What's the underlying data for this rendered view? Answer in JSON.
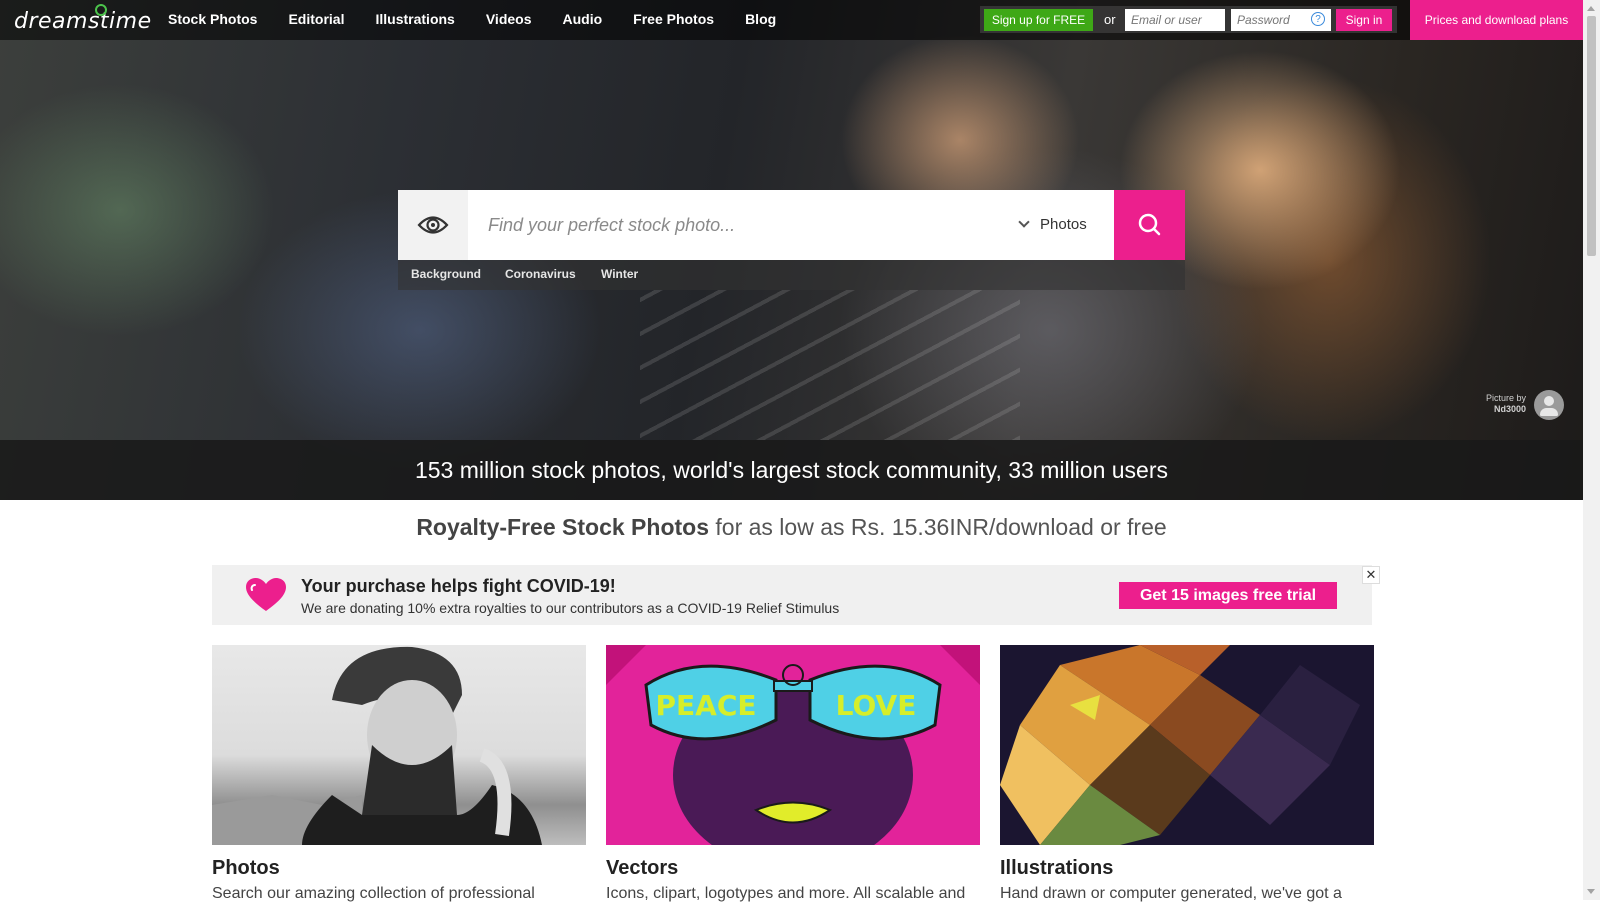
{
  "nav": {
    "logo": "dreamstime",
    "links": [
      "Stock Photos",
      "Editorial",
      "Illustrations",
      "Videos",
      "Audio",
      "Free Photos",
      "Blog"
    ],
    "signup_label": "Sign up for FREE",
    "or_label": "or",
    "email_placeholder": "Email or user",
    "password_placeholder": "Password",
    "signin_label": "Sign in",
    "prices_label": "Prices and download plans"
  },
  "search": {
    "placeholder": "Find your perfect stock photo...",
    "type_selected": "Photos",
    "tags": [
      "Background",
      "Coronavirus",
      "Winter"
    ]
  },
  "hero": {
    "credit_label": "Picture by",
    "credit_author": "Nd3000",
    "stats": "153 million stock photos, world's largest stock community, 33 million users"
  },
  "royalty": {
    "bold": "Royalty-Free Stock Photos",
    "rest": " for as low as Rs. 15.36INR/download or free"
  },
  "covid": {
    "title": "Your purchase helps fight COVID-19!",
    "subtitle": "We are donating 10% extra royalties to our contributors as a COVID-19 Relief Stimulus",
    "cta": "Get 15 images free trial",
    "close": "✕"
  },
  "cards": [
    {
      "title": "Photos",
      "desc": "Search our amazing collection of professional"
    },
    {
      "title": "Vectors",
      "desc": "Icons, clipart, logotypes and more. All scalable and"
    },
    {
      "title": "Illustrations",
      "desc": "Hand drawn or computer generated, we've got a"
    }
  ],
  "vectors_art": {
    "left_word": "PEACE",
    "right_word": "LOVE"
  },
  "colors": {
    "accent": "#ec1f8d",
    "signup": "#3ea816"
  }
}
